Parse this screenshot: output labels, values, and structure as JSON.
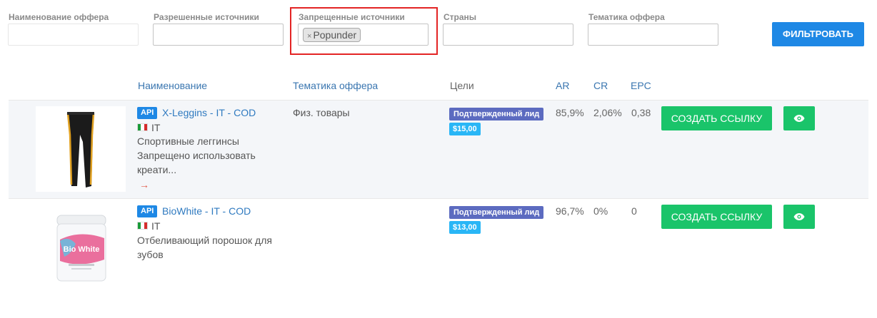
{
  "filters": {
    "offer_name": {
      "label": "Наименование оффера",
      "value": ""
    },
    "allowed_sources": {
      "label": "Разрешенные источники",
      "value": ""
    },
    "forbidden_sources": {
      "label": "Запрещенные источники",
      "tag": "Popunder",
      "tag_remove": "×"
    },
    "countries": {
      "label": "Страны",
      "value": ""
    },
    "offer_theme": {
      "label": "Тематика оффера",
      "value": ""
    },
    "filter_button": "ФИЛЬТРОВАТЬ",
    "highlight_color": "#e32424"
  },
  "table": {
    "headers": {
      "name": "Наименование",
      "theme": "Тематика оффера",
      "goals": "Цели",
      "ar": "AR",
      "cr": "CR",
      "epc": "EPC"
    },
    "rows": [
      {
        "image": "leggings-image",
        "api": "API",
        "name": "X-Leggins - IT - COD",
        "country": "IT",
        "desc": "Спортивные леггинсы Запрещено использовать креати...",
        "arrow": "→",
        "theme": "Физ. товары",
        "goal": "Подтвержденный лид",
        "price": "$15,00",
        "ar": "85,9%",
        "cr": "2,06%",
        "epc": "0,38",
        "create_label": "СОЗДАТЬ ССЫЛКУ"
      },
      {
        "image": "biowhite-jar-image",
        "api": "API",
        "name": "BioWhite - IT - COD",
        "country": "IT",
        "desc": "Отбеливающий порошок для зубов",
        "theme": "",
        "goal": "Подтвержденный лид",
        "price": "$13,00",
        "ar": "96,7%",
        "cr": "0%",
        "epc": "0",
        "create_label": "СОЗДАТЬ ССЫЛКУ",
        "jar_label": "Bio White"
      }
    ]
  },
  "colors": {
    "primary": "#1e88e5",
    "success": "#1ac46a",
    "goal_badge": "#5c6bc0",
    "price_badge": "#29b6f6",
    "link": "#2f7ac0"
  },
  "icons": [
    "eye-icon",
    "italy-flag-icon",
    "arrow-right-icon"
  ]
}
